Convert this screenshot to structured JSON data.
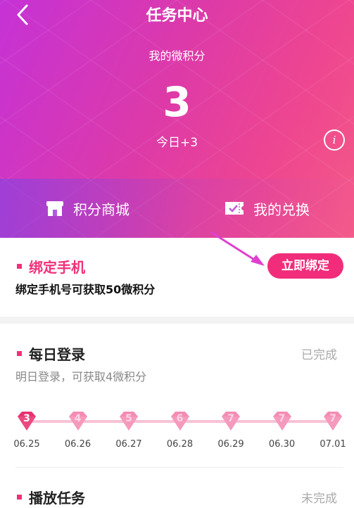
{
  "header": {
    "title": "任务中心",
    "subtitle": "我的微积分",
    "points": "3",
    "today": "今日+3",
    "info_icon": "i"
  },
  "shortcuts": [
    {
      "label": "积分商城",
      "icon": "store-icon"
    },
    {
      "label": "我的兑换",
      "icon": "ticket-icon"
    }
  ],
  "tasks": {
    "bind_phone": {
      "title": "绑定手机",
      "desc": "绑定手机号可获取50微积分",
      "button": "立即绑定"
    },
    "daily_login": {
      "title": "每日登录",
      "desc": "明日登录，可获取4微积分",
      "status": "已完成",
      "days": [
        {
          "value": "3",
          "date": "06.25",
          "active": true
        },
        {
          "value": "4",
          "date": "06.26",
          "active": false
        },
        {
          "value": "5",
          "date": "06.27",
          "active": false
        },
        {
          "value": "6",
          "date": "06.28",
          "active": false
        },
        {
          "value": "7",
          "date": "06.29",
          "active": false
        },
        {
          "value": "7",
          "date": "06.30",
          "active": false
        },
        {
          "value": "7",
          "date": "07.01",
          "active": false
        }
      ]
    },
    "play_task": {
      "title": "播放任务",
      "status": "未完成"
    }
  },
  "colors": {
    "accent": "#f12d7b",
    "gem_active": "#e8326f",
    "gem_inactive": "#f48cb3",
    "pointer": "#e040d0"
  }
}
